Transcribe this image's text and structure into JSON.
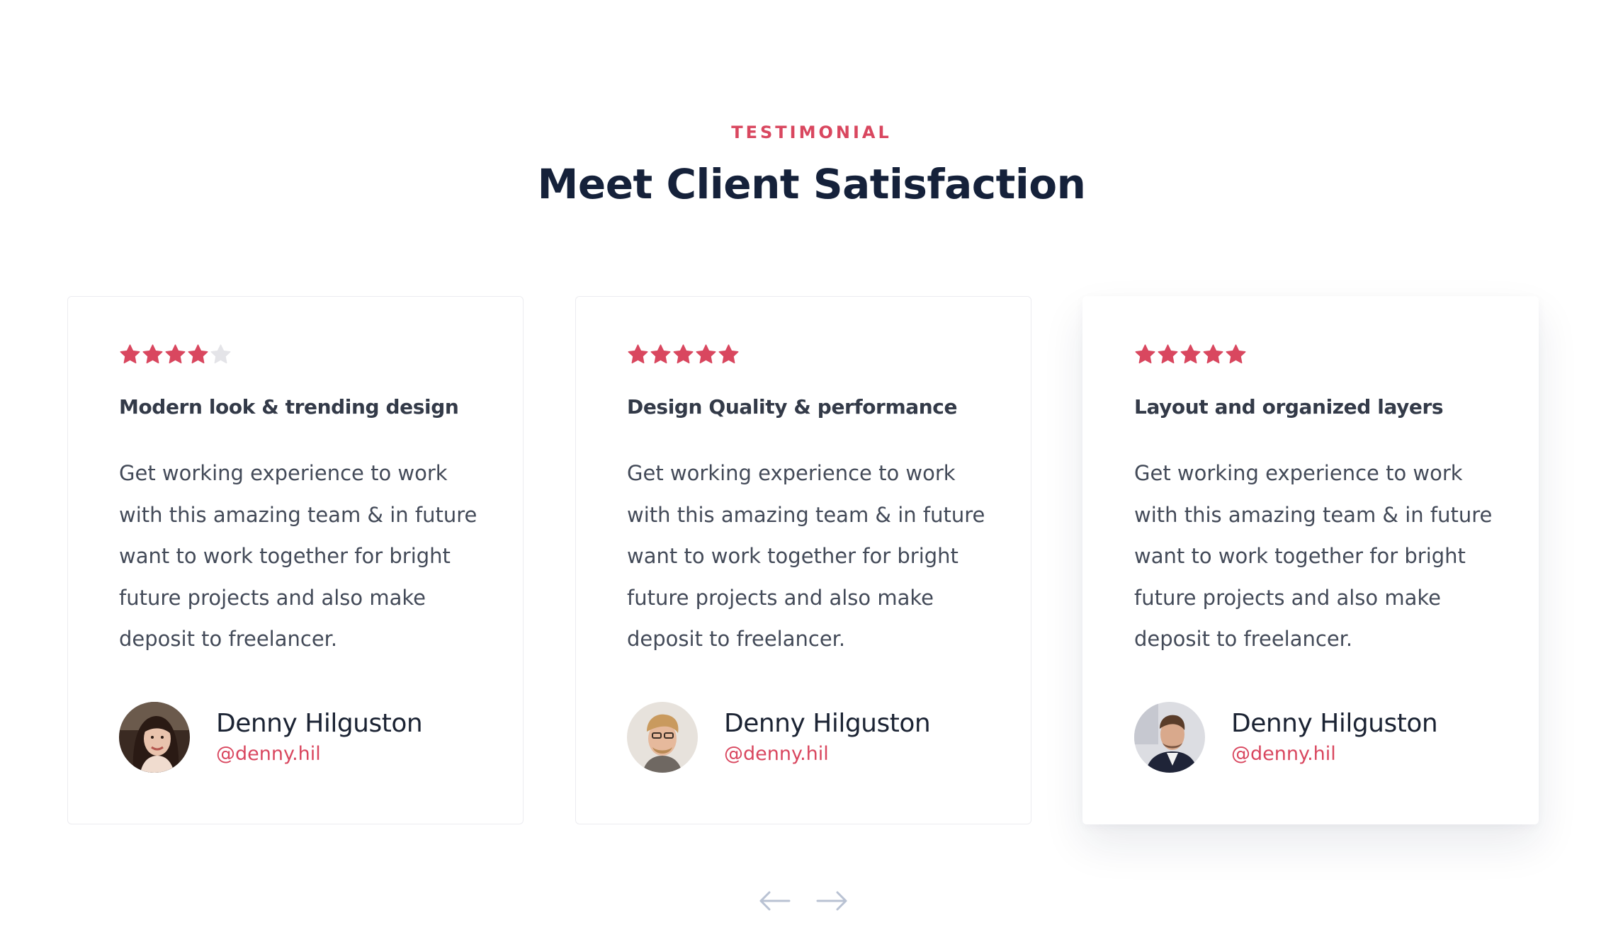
{
  "section": {
    "eyebrow": "TESTIMONIAL",
    "title": "Meet Client Satisfaction"
  },
  "colors": {
    "accent": "#d9475f",
    "star_empty": "#e4e4e8",
    "heading": "#15213a",
    "arrow": "#b9c2d3"
  },
  "testimonials": [
    {
      "rating": 4,
      "rating_max": 5,
      "title": "Modern look & trending design",
      "body": "Get working experience to work with this amazing team & in future want to work together for bright future projects and also make deposit to freelancer.",
      "author_name": "Denny Hilguston",
      "author_handle": "@denny.hil",
      "avatar": "woman-portrait"
    },
    {
      "rating": 5,
      "rating_max": 5,
      "title": "Design Quality & performance",
      "body": "Get working experience to work with this amazing team & in future want to work together for bright future projects and also make deposit to freelancer.",
      "author_name": "Denny Hilguston",
      "author_handle": "@denny.hil",
      "avatar": "man-blond-portrait"
    },
    {
      "rating": 5,
      "rating_max": 5,
      "title": "Layout and organized layers",
      "body": "Get working experience to work with this amazing team & in future want to work together for bright future projects and also make deposit to freelancer.",
      "author_name": "Denny Hilguston",
      "author_handle": "@denny.hil",
      "avatar": "man-suit-portrait"
    }
  ],
  "navigation": {
    "prev_icon": "arrow-left-icon",
    "next_icon": "arrow-right-icon"
  }
}
